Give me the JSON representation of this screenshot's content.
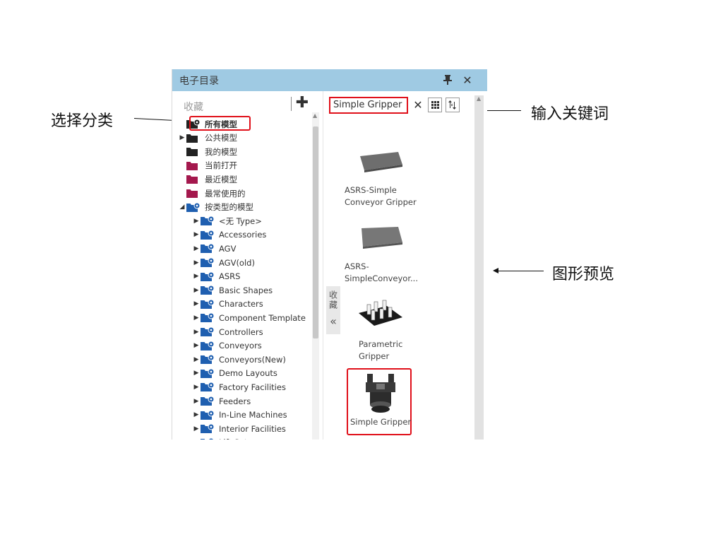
{
  "panel": {
    "title": "电子目录",
    "pin_icon": "pin-icon",
    "close_icon": "close-icon",
    "accent": "#9fcae3"
  },
  "favorites": {
    "label": "收藏",
    "add_icon": "plus-icon"
  },
  "tree": [
    {
      "label": "所有模型",
      "caret": "",
      "color": "#222222",
      "gear": true,
      "bold": true
    },
    {
      "label": "公共模型",
      "caret": "▶",
      "color": "#222222",
      "gear": false,
      "bold": false
    },
    {
      "label": "我的模型",
      "caret": "",
      "color": "#222222",
      "gear": false,
      "bold": false
    },
    {
      "label": "当前打开",
      "caret": "",
      "color": "#a4184d",
      "gear": false,
      "bold": false
    },
    {
      "label": "最近模型",
      "caret": "",
      "color": "#a4184d",
      "gear": false,
      "bold": false
    },
    {
      "label": "最常使用的",
      "caret": "",
      "color": "#a4184d",
      "gear": false,
      "bold": false
    },
    {
      "label": "按类型的模型",
      "caret": "◢",
      "color": "#1f5fb0",
      "gear": true,
      "bold": false
    },
    {
      "label": "<无 Type>",
      "caret": "▶",
      "color": "#1f5fb0",
      "gear": true,
      "bold": false
    },
    {
      "label": "Accessories",
      "caret": "▶",
      "color": "#1f5fb0",
      "gear": true,
      "bold": false
    },
    {
      "label": "AGV",
      "caret": "▶",
      "color": "#1f5fb0",
      "gear": true,
      "bold": false
    },
    {
      "label": "AGV(old)",
      "caret": "▶",
      "color": "#1f5fb0",
      "gear": true,
      "bold": false
    },
    {
      "label": "ASRS",
      "caret": "▶",
      "color": "#1f5fb0",
      "gear": true,
      "bold": false
    },
    {
      "label": "Basic Shapes",
      "caret": "▶",
      "color": "#1f5fb0",
      "gear": true,
      "bold": false
    },
    {
      "label": "Characters",
      "caret": "▶",
      "color": "#1f5fb0",
      "gear": true,
      "bold": false
    },
    {
      "label": "Component Template",
      "caret": "▶",
      "color": "#1f5fb0",
      "gear": true,
      "bold": false
    },
    {
      "label": "Controllers",
      "caret": "▶",
      "color": "#1f5fb0",
      "gear": true,
      "bold": false
    },
    {
      "label": "Conveyors",
      "caret": "▶",
      "color": "#1f5fb0",
      "gear": true,
      "bold": false
    },
    {
      "label": "Conveyors(New)",
      "caret": "▶",
      "color": "#1f5fb0",
      "gear": true,
      "bold": false
    },
    {
      "label": "Demo Layouts",
      "caret": "▶",
      "color": "#1f5fb0",
      "gear": true,
      "bold": false
    },
    {
      "label": "Factory Facilities",
      "caret": "▶",
      "color": "#1f5fb0",
      "gear": true,
      "bold": false
    },
    {
      "label": "Feeders",
      "caret": "▶",
      "color": "#1f5fb0",
      "gear": true,
      "bold": false
    },
    {
      "label": "In-Line Machines",
      "caret": "▶",
      "color": "#1f5fb0",
      "gear": true,
      "bold": false
    },
    {
      "label": "Interior Facilities",
      "caret": "▶",
      "color": "#1f5fb0",
      "gear": true,
      "bold": false
    },
    {
      "label": "Lift Sets",
      "caret": "▶",
      "color": "#1f5fb0",
      "gear": true,
      "bold": false
    }
  ],
  "search": {
    "value": "Simple Gripper",
    "clear_icon": "x-icon",
    "grid_icon": "grid-view-icon",
    "sort_icon": "sort-icon"
  },
  "side_tab": {
    "label": "收藏",
    "collapse": "«"
  },
  "results": [
    {
      "line1": "ASRS-Simple",
      "line2": "Conveyor Gripper",
      "thumb": "flat-plate-thumbnail"
    },
    {
      "line1": "ASRS-",
      "line2": "SimpleConveyor...",
      "thumb": "flat-plate-thumbnail"
    },
    {
      "line1": "Parametric",
      "line2": "Gripper",
      "thumb": "multi-finger-gripper-thumbnail"
    },
    {
      "line1": "Simple Gripper",
      "line2": "",
      "thumb": "gripper-thumbnail"
    }
  ],
  "annotations": {
    "left": "选择分类",
    "right_top": "输入关键词",
    "right_mid": "图形预览"
  },
  "colors": {
    "highlight": "#e0101a"
  }
}
